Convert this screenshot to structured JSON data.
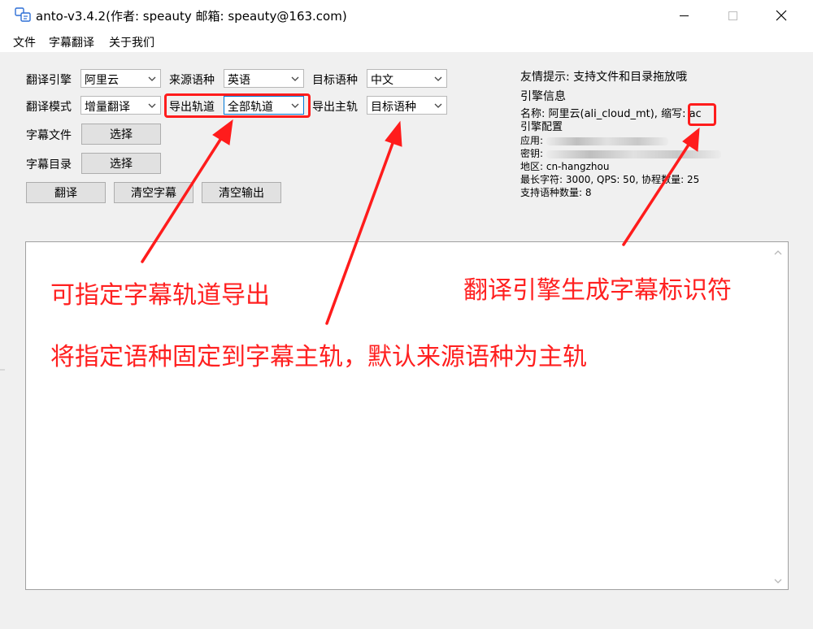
{
  "window": {
    "title": "anto-v3.4.2(作者: speauty 邮箱: speauty@163.com)"
  },
  "menu": {
    "items": [
      "文件",
      "字幕翻译",
      "关于我们"
    ]
  },
  "form": {
    "engine_label": "翻译引擎",
    "engine_value": "阿里云",
    "source_lang_label": "来源语种",
    "source_lang_value": "英语",
    "target_lang_label": "目标语种",
    "target_lang_value": "中文",
    "mode_label": "翻译模式",
    "mode_value": "增量翻译",
    "export_track_label": "导出轨道",
    "export_track_value": "全部轨道",
    "export_main_label": "导出主轨",
    "export_main_value": "目标语种",
    "subtitle_file_label": "字幕文件",
    "subtitle_file_button": "选择",
    "subtitle_dir_label": "字幕目录",
    "subtitle_dir_button": "选择"
  },
  "actions": {
    "translate": "翻译",
    "clear_subtitles": "清空字幕",
    "clear_output": "清空输出"
  },
  "info": {
    "tip": "友情提示: 支持文件和目录拖放哦",
    "engine_info_heading": "引擎信息",
    "name_line": "名称: 阿里云(ali_cloud_mt), 缩写: ac",
    "config_heading": "引擎配置",
    "app_label": "应用:",
    "secret_label": "密钥:",
    "region_line": "地区: cn-hangzhou",
    "limits_line": "最长字符: 3000, QPS: 50, 协程数量: 25",
    "lang_count_line": "支持语种数量: 8"
  },
  "output": {
    "value": ""
  },
  "annotations": {
    "track_note": "可指定字幕轨道导出",
    "main_track_note": "将指定语种固定到字幕主轨，默认来源语种为主轨",
    "identifier_note": "翻译引擎生成字幕标识符"
  },
  "colors": {
    "annotation_red": "#ff2020",
    "window_bg": "#f0f0f0"
  }
}
